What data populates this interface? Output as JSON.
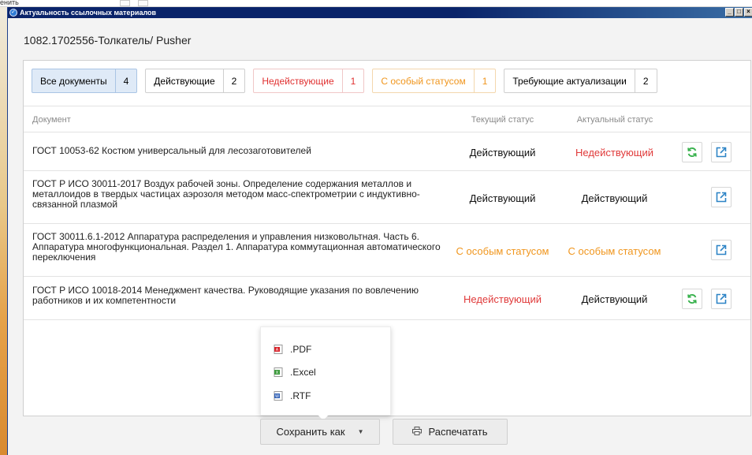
{
  "background": {
    "fragment_text": "енить"
  },
  "window": {
    "title": "Актуальность ссылочных материалов",
    "buttons": {
      "minimize": "_",
      "maximize": "□",
      "close": "×"
    }
  },
  "doc_title": "1082.1702556-Толкатель/ Pusher",
  "filters": [
    {
      "label": "Все документы",
      "count": "4",
      "state": "active"
    },
    {
      "label": "Действующие",
      "count": "2",
      "state": "normal"
    },
    {
      "label": "Недействующие",
      "count": "1",
      "state": "red"
    },
    {
      "label": "С особый статусом",
      "count": "1",
      "state": "orange"
    },
    {
      "label": "Требующие актуализации",
      "count": "2",
      "state": "normal"
    }
  ],
  "table": {
    "headers": {
      "document": "Документ",
      "current": "Текущий статус",
      "actual": "Актуальный статус"
    },
    "rows": [
      {
        "document": "ГОСТ 10053-62 Костюм универсальный для лесозаготовителей",
        "current": "Действующий",
        "actual": "Недействующий",
        "actions": [
          "refresh",
          "open"
        ]
      },
      {
        "document": "ГОСТ Р ИСО 30011-2017 Воздух рабочей зоны. Определение содержания металлов и металлоидов в твердых частицах аэрозоля методом масс-спектрометрии с индуктивно-связанной плазмой",
        "current": "Действующий",
        "actual": "Действующий",
        "actions": [
          "open"
        ]
      },
      {
        "document": "ГОСТ 30011.6.1-2012 Аппаратура распределения и управления низковольтная. Часть 6. Аппаратура многофункциональная. Раздел 1. Аппаратура коммутационная автоматического переключения",
        "current": "С особым статусом",
        "actual": "С особым статусом",
        "actions": [
          "open"
        ]
      },
      {
        "document": "ГОСТ Р ИСО 10018-2014 Менеджмент качества. Руководящие указания по вовлечению работников и их компетентности",
        "current": "Недействующий",
        "actual": "Действующий",
        "actions": [
          "refresh",
          "open"
        ]
      }
    ]
  },
  "save_menu": {
    "items": [
      {
        "label": ".PDF",
        "icon": "pdf-file-icon"
      },
      {
        "label": ".Excel",
        "icon": "excel-file-icon"
      },
      {
        "label": ".RTF",
        "icon": "rtf-file-icon"
      }
    ]
  },
  "footer": {
    "save_as": "Сохранить как",
    "print": "Распечатать"
  },
  "colors": {
    "red": "#e03a3a",
    "orange": "#f0961e",
    "active_tab": "#dfeaf7",
    "refresh_green": "#35b04a",
    "open_blue": "#2d84c6"
  }
}
